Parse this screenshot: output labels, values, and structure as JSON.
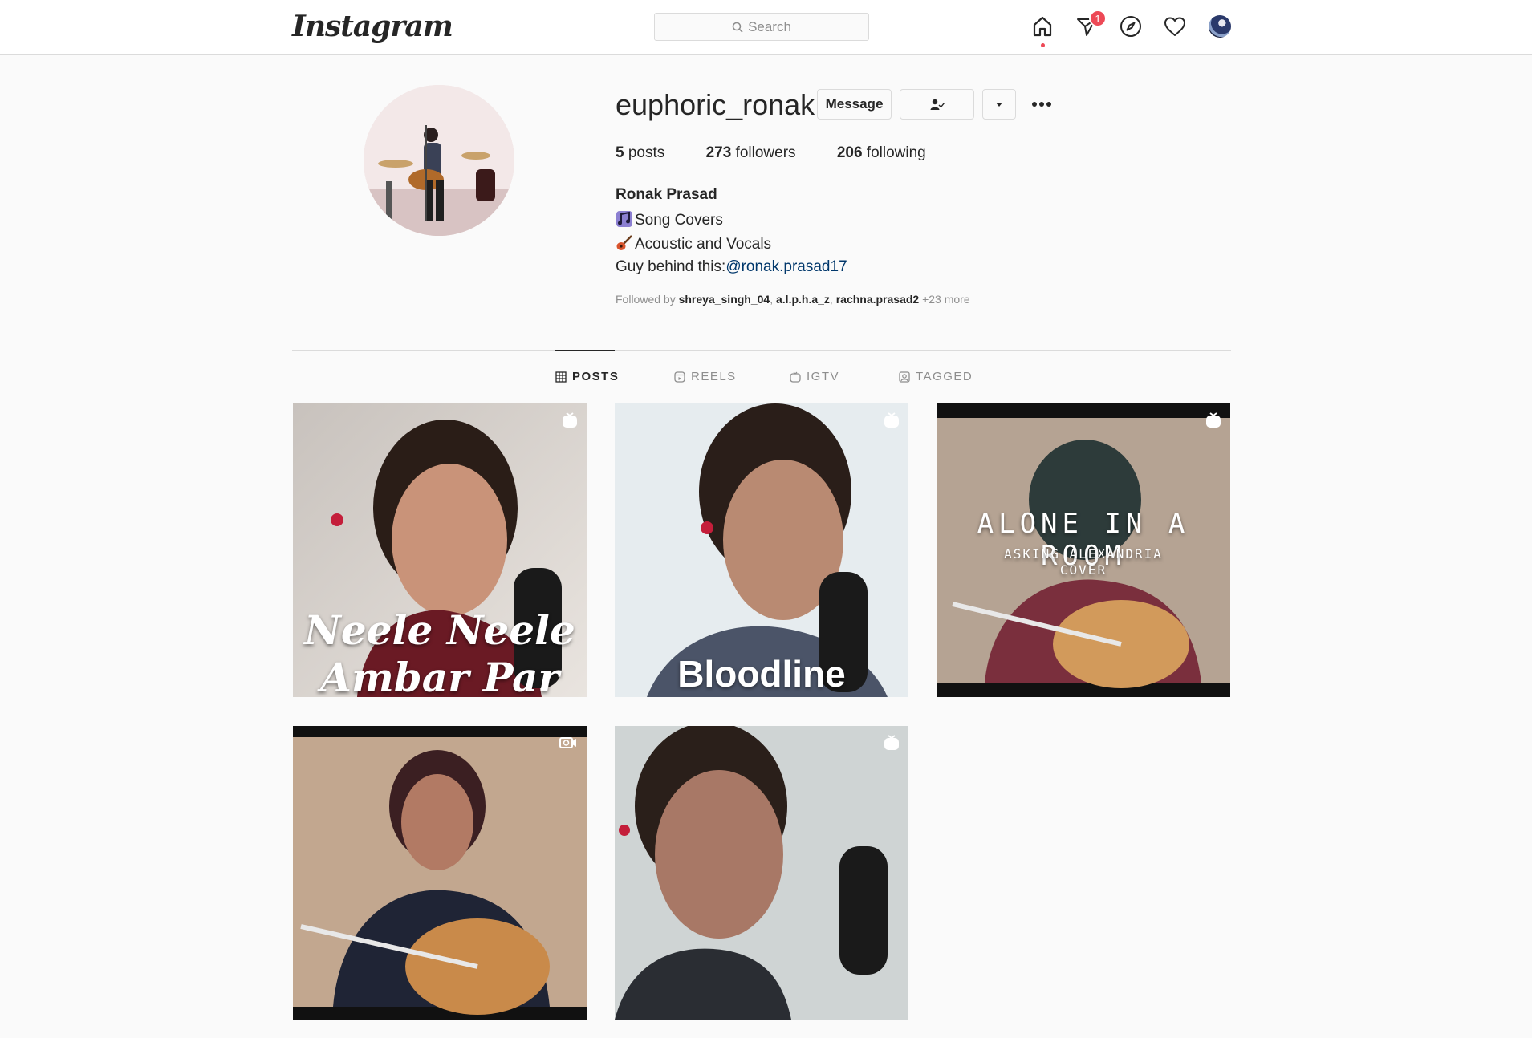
{
  "nav": {
    "logo": "Instagram",
    "search_placeholder": "Search",
    "notification_count": "1"
  },
  "profile": {
    "username": "euphoric_ronak",
    "message_label": "Message",
    "stats": {
      "posts_count": "5",
      "posts_label": "posts",
      "followers_count": "273",
      "followers_label": "followers",
      "following_count": "206",
      "following_label": "following"
    },
    "full_name": "Ronak Prasad",
    "bio": {
      "line1": "Song Covers",
      "line2": "Acoustic and Vocals",
      "line3_prefix": "Guy behind this:",
      "line3_mention": "@ronak.prasad17"
    },
    "followed_by": {
      "prefix": "Followed by ",
      "user1": "shreya_singh_04",
      "sep1": ", ",
      "user2": "a.l.p.h.a_z",
      "sep2": ", ",
      "user3": "rachna.prasad2",
      "more": " +23 more"
    }
  },
  "tabs": [
    {
      "label": "POSTS",
      "icon": "grid-icon",
      "active": true
    },
    {
      "label": "REELS",
      "icon": "reels-icon",
      "active": false
    },
    {
      "label": "IGTV",
      "icon": "igtv-icon",
      "active": false
    },
    {
      "label": "TAGGED",
      "icon": "tagged-icon",
      "active": false
    }
  ],
  "posts": [
    {
      "caption_line1": "Neele Neele",
      "caption_line2": "Ambar Par",
      "type_icon": "igtv-icon"
    },
    {
      "caption_line1": "Bloodline",
      "type_icon": "igtv-icon"
    },
    {
      "caption_line1": "ALONE IN A ROOM",
      "caption_line2": "ASKING ALEXANDRIA",
      "caption_line3": "COVER",
      "type_icon": "igtv-icon"
    },
    {
      "type_icon": "video-icon"
    },
    {
      "type_icon": "igtv-icon"
    }
  ],
  "colors": {
    "notification_red": "#ed4956",
    "link_blue": "#00376b",
    "border": "#dbdbdb"
  }
}
